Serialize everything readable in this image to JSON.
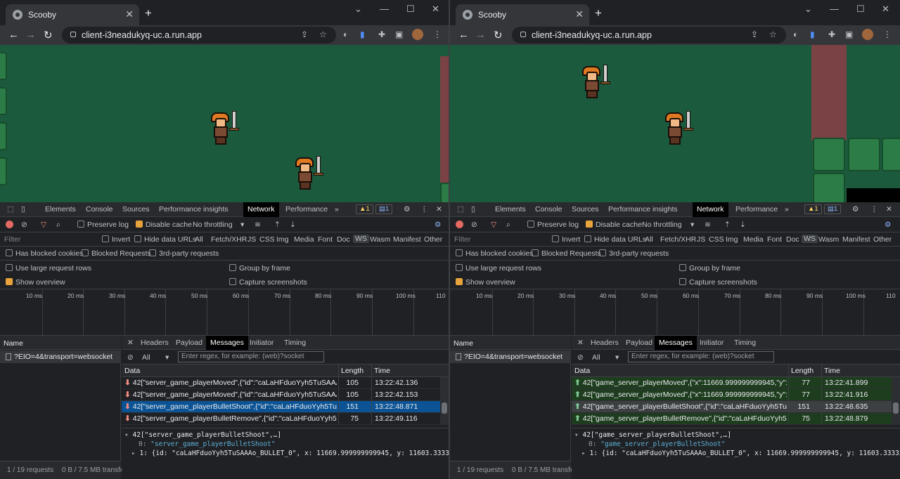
{
  "left": {
    "tab_title": "Scooby",
    "url": "client-i3neadukyq-uc.a.run.app",
    "devtools_tabs": [
      "Elements",
      "Console",
      "Sources",
      "Performance insights",
      "Network",
      "Performance"
    ],
    "warnings": "1",
    "messages_count": "1",
    "preserve_log": "Preserve log",
    "disable_cache": "Disable cache",
    "throttling": "No throttling",
    "filter_placeholder": "Filter",
    "invert": "Invert",
    "hide_data_urls": "Hide data URLs",
    "filter_types": [
      "All",
      "Fetch/XHR",
      "JS",
      "CSS",
      "Img",
      "Media",
      "Font",
      "Doc",
      "WS",
      "Wasm",
      "Manifest",
      "Other"
    ],
    "has_blocked": "Has blocked cookies",
    "blocked_requests": "Blocked Requests",
    "third_party": "3rd-party requests",
    "large_rows": "Use large request rows",
    "group_by_frame": "Group by frame",
    "show_overview": "Show overview",
    "capture_screens": "Capture screenshots",
    "timeline": [
      "10 ms",
      "20 ms",
      "30 ms",
      "40 ms",
      "50 ms",
      "60 ms",
      "70 ms",
      "80 ms",
      "90 ms",
      "100 ms",
      "110"
    ],
    "name_header": "Name",
    "request_name": "?EIO=4&transport=websocket",
    "detail_tabs": [
      "Headers",
      "Payload",
      "Messages",
      "Initiator",
      "Timing"
    ],
    "msg_filter_all": "All",
    "regex_placeholder": "Enter regex, for example: (web)?socket",
    "col_data": "Data",
    "col_length": "Length",
    "col_time": "Time",
    "rows": [
      {
        "data": "42[\"server_game_playerMoved\",{\"id\":\"caLaHFduoYyh5TuSAAAo\",\"x\":...",
        "length": "105",
        "time": "13:22:42.136"
      },
      {
        "data": "42[\"server_game_playerMoved\",{\"id\":\"caLaHFduoYyh5TuSAAAo\",\"x\":...",
        "length": "105",
        "time": "13:22:42.153"
      },
      {
        "data": "42[\"server_game_playerBulletShoot\",{\"id\":\"caLaHFduoYyh5TuSAAAo...",
        "length": "151",
        "time": "13:22:48.871"
      },
      {
        "data": "42[\"server_game_playerBulletRemove\",{\"id\":\"caLaHFduoYyh5TuSAA...",
        "length": "75",
        "time": "13:22:49.116"
      }
    ],
    "tree_head": "42[\"server_game_playerBulletShoot\",…]",
    "tree_0_key": "0:",
    "tree_0_val": "\"server_game_playerBulletShoot\"",
    "tree_1": "1: {id: \"caLaHFduoYyh5TuSAAAo_BULLET_0\", x: 11669.999999999945, y: 11603.3333333333333",
    "status_requests": "1 / 19 requests",
    "status_transfer": "0 B / 7.5 MB transfe"
  },
  "right": {
    "tab_title": "Scooby",
    "url": "client-i3neadukyq-uc.a.run.app",
    "devtools_tabs": [
      "Elements",
      "Console",
      "Sources",
      "Performance insights",
      "Network",
      "Performance"
    ],
    "warnings": "1",
    "messages_count": "1",
    "preserve_log": "Preserve log",
    "disable_cache": "Disable cache",
    "throttling": "No throttling",
    "filter_placeholder": "Filter",
    "invert": "Invert",
    "hide_data_urls": "Hide data URLs",
    "filter_types": [
      "All",
      "Fetch/XHR",
      "JS",
      "CSS",
      "Img",
      "Media",
      "Font",
      "Doc",
      "WS",
      "Wasm",
      "Manifest",
      "Other"
    ],
    "has_blocked": "Has blocked cookies",
    "blocked_requests": "Blocked Requests",
    "third_party": "3rd-party requests",
    "large_rows": "Use large request rows",
    "group_by_frame": "Group by frame",
    "show_overview": "Show overview",
    "capture_screens": "Capture screenshots",
    "timeline": [
      "10 ms",
      "20 ms",
      "30 ms",
      "40 ms",
      "50 ms",
      "60 ms",
      "70 ms",
      "80 ms",
      "90 ms",
      "100 ms",
      "110"
    ],
    "name_header": "Name",
    "request_name": "?EIO=4&transport=websocket",
    "detail_tabs": [
      "Headers",
      "Payload",
      "Messages",
      "Initiator",
      "Timing"
    ],
    "msg_filter_all": "All",
    "regex_placeholder": "Enter regex, for example: (web)?socket",
    "col_data": "Data",
    "col_length": "Length",
    "col_time": "Time",
    "rows": [
      {
        "data": "42[\"game_server_playerMoved\",{\"x\":11669.999999999945,\"y\":11594....",
        "length": "77",
        "time": "13:22:41.899"
      },
      {
        "data": "42[\"game_server_playerMoved\",{\"x\":11669.999999999945,\"y\":11603....",
        "length": "77",
        "time": "13:22:41.916"
      },
      {
        "data": "42[\"game_server_playerBulletShoot\",{\"id\":\"caLaHFduoYyh5TuSAAAo...",
        "length": "151",
        "time": "13:22:48.635"
      },
      {
        "data": "42[\"game_server_playerBulletRemove\",{\"id\":\"caLaHFduoYyh5TuSAA...",
        "length": "75",
        "time": "13:22:48.879"
      }
    ],
    "tree_head": "42[\"game_server_playerBulletShoot\",…]",
    "tree_0_key": "0:",
    "tree_0_val": "\"game_server_playerBulletShoot\"",
    "tree_1": "1: {id: \"caLaHFduoYyh5TuSAAAo_BULLET_0\", x: 11669.999999999945, y: 11603.3333333333333",
    "status_requests": "1 / 19 requests",
    "status_transfer": "0 B / 7.5 MB transfe"
  },
  "colors": {
    "game_bg": "#1c5a3e",
    "selected_row": "#0b5394",
    "sent_row": "#1e3d1e",
    "accent": "#e8a33d"
  },
  "icons": [
    "globe-icon",
    "close-icon",
    "plus-icon",
    "minimize-icon",
    "maximize-icon",
    "back-icon",
    "forward-icon",
    "reload-icon",
    "lock-icon",
    "share-icon",
    "star-icon",
    "extensions-icon",
    "sidebar-icon",
    "menu-icon",
    "record-icon",
    "clear-icon",
    "funnel-icon",
    "search-icon",
    "upload-icon",
    "download-icon",
    "gear-icon"
  ]
}
